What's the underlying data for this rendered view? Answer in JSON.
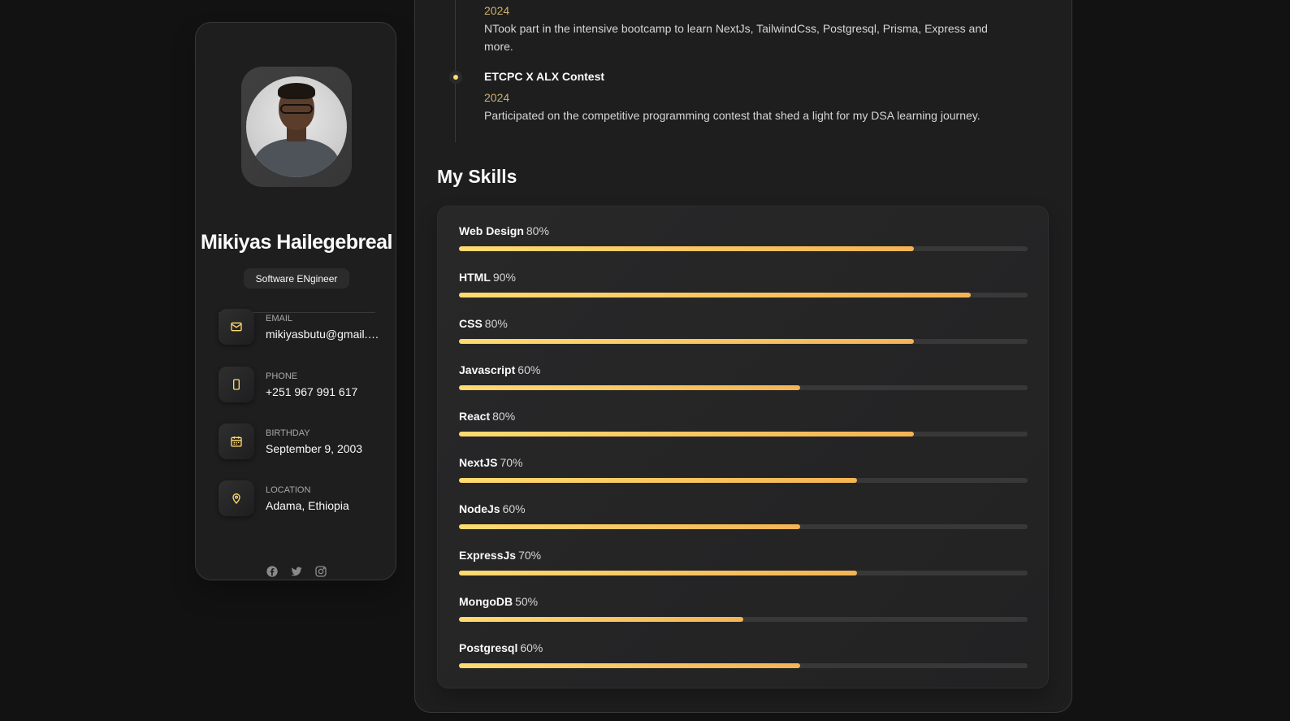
{
  "profile": {
    "name": "Mikiyas Hailegebreal",
    "title": "Software ENgineer",
    "avatar_icon": "profile-photo"
  },
  "contacts": [
    {
      "label": "EMAIL",
      "value": "mikiyasbutu@gmail.com",
      "icon": "mail-icon"
    },
    {
      "label": "PHONE",
      "value": "+251 967 991 617",
      "icon": "phone-icon"
    },
    {
      "label": "BIRTHDAY",
      "value": "September 9, 2003",
      "icon": "calendar-icon"
    },
    {
      "label": "LOCATION",
      "value": "Adama, Ethiopia",
      "icon": "location-icon"
    }
  ],
  "socials": [
    "facebook-icon",
    "twitter-icon",
    "instagram-icon"
  ],
  "timeline": [
    {
      "year": "2024",
      "text": "NTook part in the intensive bootcamp to learn NextJs, TailwindCss, Postgresql, Prisma, Express and more."
    },
    {
      "title": "ETCPC X ALX Contest",
      "year": "2024",
      "text": "Participated on the competitive programming contest that shed a light for my DSA learning journey."
    }
  ],
  "skills": {
    "heading": "My Skills",
    "items": [
      {
        "name": "Web Design",
        "percent": 80,
        "percent_label": "80%"
      },
      {
        "name": "HTML",
        "percent": 90,
        "percent_label": "90%"
      },
      {
        "name": "CSS",
        "percent": 80,
        "percent_label": "80%"
      },
      {
        "name": "Javascript",
        "percent": 60,
        "percent_label": "60%"
      },
      {
        "name": "React",
        "percent": 80,
        "percent_label": "80%"
      },
      {
        "name": "NextJS",
        "percent": 70,
        "percent_label": "70%"
      },
      {
        "name": "NodeJs",
        "percent": 60,
        "percent_label": "60%"
      },
      {
        "name": "ExpressJs",
        "percent": 70,
        "percent_label": "70%"
      },
      {
        "name": "MongoDB",
        "percent": 50,
        "percent_label": "50%"
      },
      {
        "name": "Postgresql",
        "percent": 60,
        "percent_label": "60%"
      }
    ]
  },
  "colors": {
    "accent": "#ffdb70",
    "accent_dark": "#f4b455",
    "year": "#ceb16d",
    "background": "#121212",
    "card": "#1e1e1f"
  }
}
